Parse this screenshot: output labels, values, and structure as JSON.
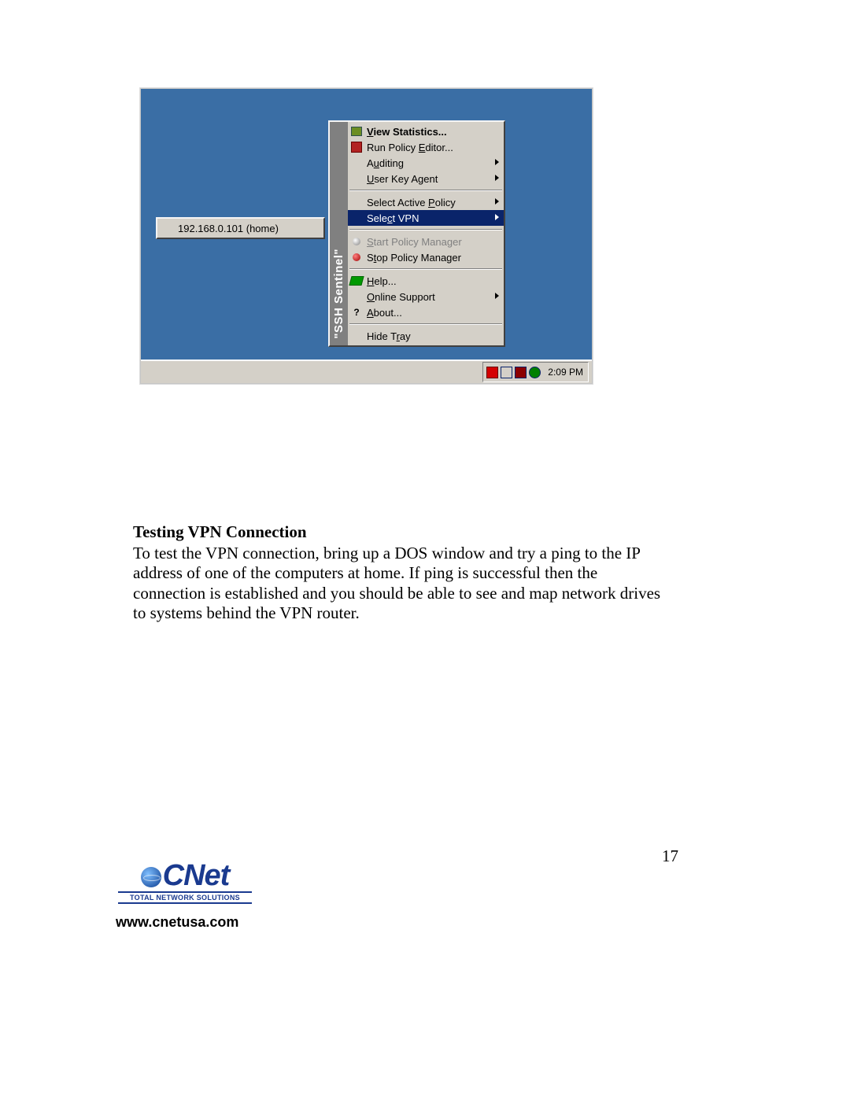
{
  "screenshot": {
    "gutter_label": "\"SSH Sentinel\"",
    "submenu": {
      "item": "192.168.0.101 (home)"
    },
    "menu": {
      "view_statistics": "View Statistics...",
      "run_policy_editor": "Run Policy Editor...",
      "auditing": "Auditing",
      "user_key_agent": "User Key Agent",
      "select_active_policy": "Select Active Policy",
      "select_vpn": "Select VPN",
      "start_policy_manager": "Start Policy Manager",
      "stop_policy_manager": "Stop Policy Manager",
      "help": "Help...",
      "online_support": "Online Support",
      "about": "About...",
      "hide_tray": "Hide Tray"
    },
    "clock": "2:09 PM"
  },
  "doc": {
    "heading": "Testing VPN Connection",
    "body": "To test the VPN connection, bring up a DOS window and try a ping to the IP address of one of the computers at home.  If ping is successful then the connection is established and you should be able to see and map network drives to systems behind the VPN router."
  },
  "footer": {
    "page": "17",
    "logo_text": "CNet",
    "tagline": "TOTAL NETWORK SOLUTIONS",
    "url": "www.cnetusa.com"
  }
}
